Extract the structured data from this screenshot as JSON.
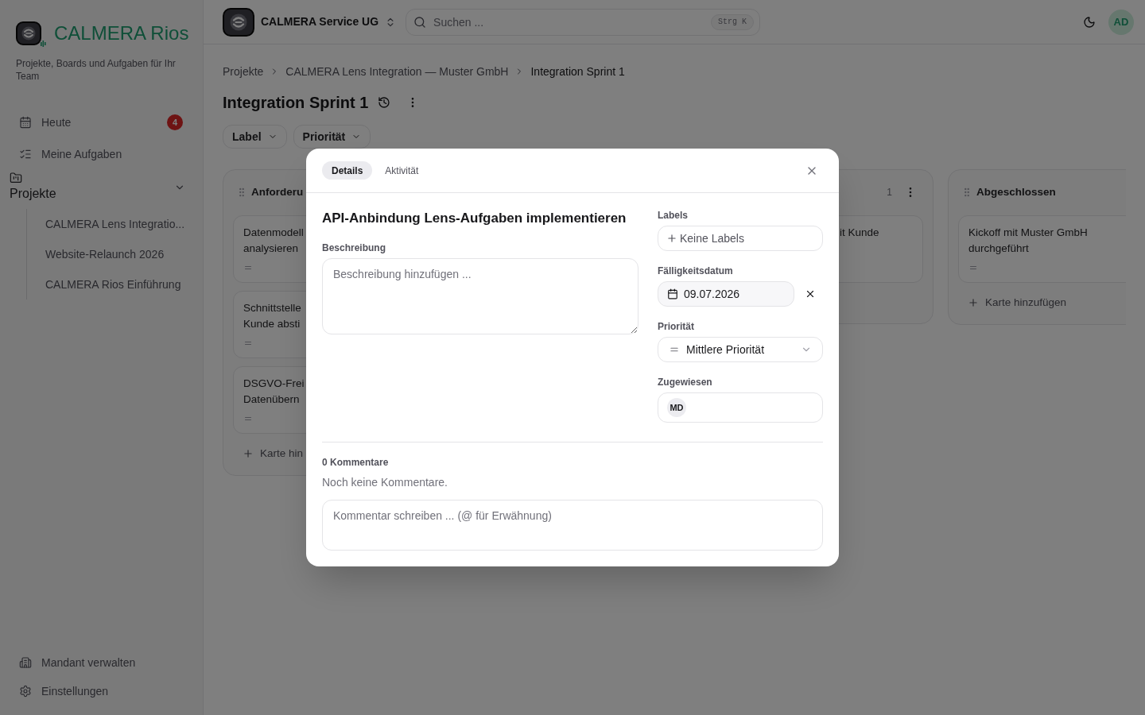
{
  "sidebar": {
    "brand": "CALMERA Rios",
    "tagline": "Projekte, Boards und Aufgaben für Ihr Team",
    "nav": [
      {
        "kind": "calendar",
        "label": "Heute",
        "badge": "4"
      },
      {
        "kind": "checklist",
        "label": "Meine Aufgaben"
      }
    ],
    "projects": {
      "label": "Projekte",
      "expanded": true,
      "items": [
        "CALMERA Lens Integratio...",
        "Website-Relaunch 2026",
        "CALMERA Rios Einführung"
      ]
    },
    "footer": [
      {
        "kind": "building",
        "label": "Mandant verwalten"
      },
      {
        "kind": "gear",
        "label": "Einstellungen"
      }
    ]
  },
  "topbar": {
    "workspace": "CALMERA Service UG",
    "search": {
      "placeholder": "Suchen ...",
      "shortcut": "Strg K"
    },
    "avatar": "AD"
  },
  "breadcrumb": [
    "Projekte",
    "CALMERA Lens Integration — Muster GmbH",
    "Integration Sprint 1"
  ],
  "board": {
    "title": "Integration Sprint 1",
    "filters": [
      "Label",
      "Priorität"
    ],
    "columns": [
      {
        "title": "Anforderu",
        "cards": [
          {
            "lines": [
              "Datenmodell",
              "analysieren"
            ],
            "kind": "medium"
          },
          {
            "lines": [
              "Schnittstelle",
              "Kunde absti"
            ],
            "kind": "medium"
          },
          {
            "lines": [
              "DSGVO-Frei",
              "Datenübern"
            ],
            "kind": "medium"
          }
        ],
        "add": "Karte hin"
      },
      {
        "count": "1",
        "cards": [
          {
            "lines": [
              "it Kunde"
            ]
          }
        ]
      },
      {
        "title": "Abgeschlossen",
        "cards": [
          {
            "lines": [
              "Kickoff mit Muster GmbH",
              "durchgeführt"
            ],
            "kind": "medium"
          }
        ],
        "add": "Karte hinzufügen"
      }
    ]
  },
  "dialog": {
    "tabs": [
      {
        "label": "Details",
        "selected": true
      },
      {
        "label": "Aktivität",
        "selected": false
      }
    ],
    "title": "API-Anbindung Lens-Aufgaben implementieren",
    "description": {
      "label": "Beschreibung",
      "placeholder": "Beschreibung hinzufügen ..."
    },
    "labels": {
      "label": "Labels",
      "button": "Keine Labels"
    },
    "due_date": {
      "label": "Fälligkeitsdatum",
      "value": "09.07.2026"
    },
    "priority": {
      "label": "Priorität",
      "value": "Mittlere Priorität",
      "kind": "medium"
    },
    "assignee": {
      "label": "Zugewiesen",
      "avatars": [
        "MD"
      ]
    },
    "comments": {
      "count": "0 Kommentare",
      "empty": "Noch keine Kommentare.",
      "placeholder": "Kommentar schreiben ... (@ für Erwähnung)"
    }
  }
}
